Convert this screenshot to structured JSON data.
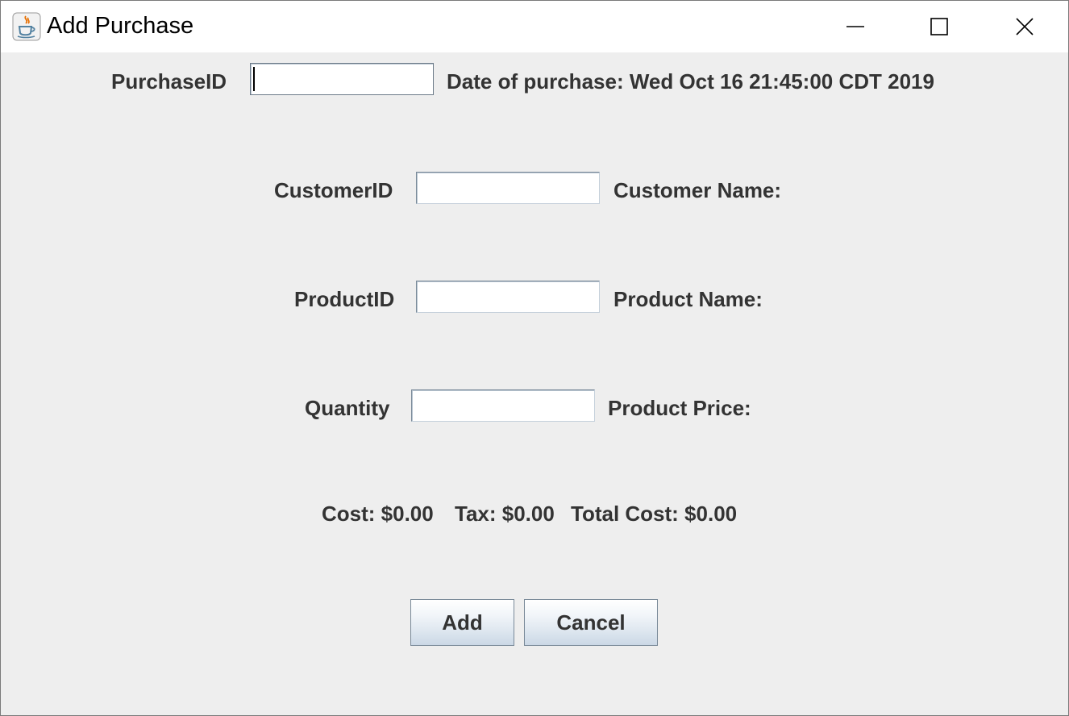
{
  "window": {
    "title": "Add Purchase",
    "icon": "java-icon",
    "controls": {
      "minimize": "minimize-icon",
      "maximize": "maximize-icon",
      "close": "close-icon"
    }
  },
  "form": {
    "purchase_id": {
      "label": "PurchaseID",
      "value": "",
      "info": "Date of purchase: Wed Oct 16 21:45:00 CDT 2019"
    },
    "customer_id": {
      "label": "CustomerID",
      "value": "",
      "info": "Customer Name:"
    },
    "product_id": {
      "label": "ProductID",
      "value": "",
      "info": "Product Name:"
    },
    "quantity": {
      "label": "Quantity",
      "value": "",
      "info": "Product Price:"
    }
  },
  "totals": {
    "cost": "Cost: $0.00",
    "tax": "Tax: $0.00",
    "total": "Total Cost: $0.00"
  },
  "buttons": {
    "add": "Add",
    "cancel": "Cancel"
  },
  "colors": {
    "window_bg": "#eeeeee",
    "titlebar_bg": "#ffffff",
    "label_text": "#333333"
  }
}
